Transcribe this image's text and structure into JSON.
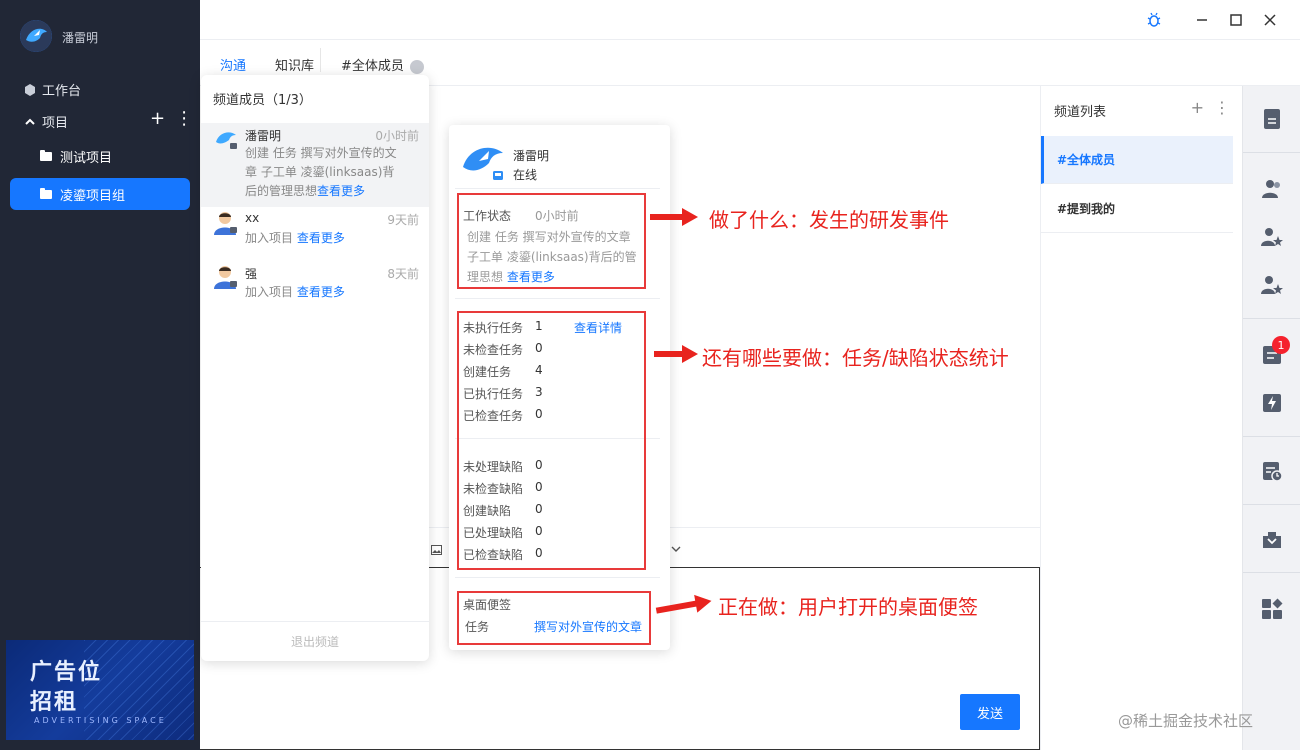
{
  "sidebar": {
    "username": "潘雷明",
    "workbench": "工作台",
    "projects_label": "项目",
    "projects": [
      {
        "label": "测试项目",
        "active": false
      },
      {
        "label": "凌鎏项目组",
        "active": true
      }
    ],
    "ad": {
      "line1": "广告位",
      "line2": "招租",
      "line3": "ADVERTISING SPACE"
    }
  },
  "tabs": {
    "chat": "沟通",
    "kb": "知识库",
    "channel": "#全体成员"
  },
  "members": {
    "title": "频道成员（1/3）",
    "leave": "退出频道",
    "list": [
      {
        "name": "潘雷明",
        "time": "0小时前",
        "desc": "创建 任务 撰写对外宣传的文章 子工单 凌鎏(linksaas)背后的管理思想",
        "more": "查看更多"
      },
      {
        "name": "xx",
        "time": "9天前",
        "desc": "加入项目",
        "more": "查看更多"
      },
      {
        "name": "强",
        "time": "8天前",
        "desc": "加入项目",
        "more": "查看更多"
      }
    ]
  },
  "card": {
    "name": "潘雷明",
    "status": "在线",
    "work_label": "工作状态",
    "work_time": "0小时前",
    "work_desc": "创建 任务 撰写对外宣传的文章 子工单 凌鎏(linksaas)背后的管理思想",
    "work_more": "查看更多",
    "task_detail": "查看详情",
    "task_stats": [
      {
        "label": "未执行任务",
        "value": "1"
      },
      {
        "label": "未检查任务",
        "value": "0"
      },
      {
        "label": "创建任务",
        "value": "4"
      },
      {
        "label": "已执行任务",
        "value": "3"
      },
      {
        "label": "已检查任务",
        "value": "0"
      }
    ],
    "bug_stats": [
      {
        "label": "未处理缺陷",
        "value": "0"
      },
      {
        "label": "未检查缺陷",
        "value": "0"
      },
      {
        "label": "创建缺陷",
        "value": "0"
      },
      {
        "label": "已处理缺陷",
        "value": "0"
      },
      {
        "label": "已检查缺陷",
        "value": "0"
      }
    ],
    "note_label": "桌面便签",
    "note_task_label": "任务",
    "note_task_value": "撰写对外宣传的文章"
  },
  "annotations": {
    "a1": "做了什么：发生的研发事件",
    "a2": "还有哪些要做：任务/缺陷状态统计",
    "a3": "正在做：用户打开的桌面便签"
  },
  "channels": {
    "title": "频道列表",
    "items": [
      {
        "label": "#全体成员",
        "active": true
      },
      {
        "label": "#提到我的",
        "active": false
      }
    ]
  },
  "compose": {
    "send": "发送"
  },
  "icon_bar": {
    "badge": "1"
  },
  "watermark": "@稀土掘金技术社区",
  "colors": {
    "sidebar_bg": "#212736",
    "accent": "#1677ff",
    "annotation": "#e8231e"
  }
}
